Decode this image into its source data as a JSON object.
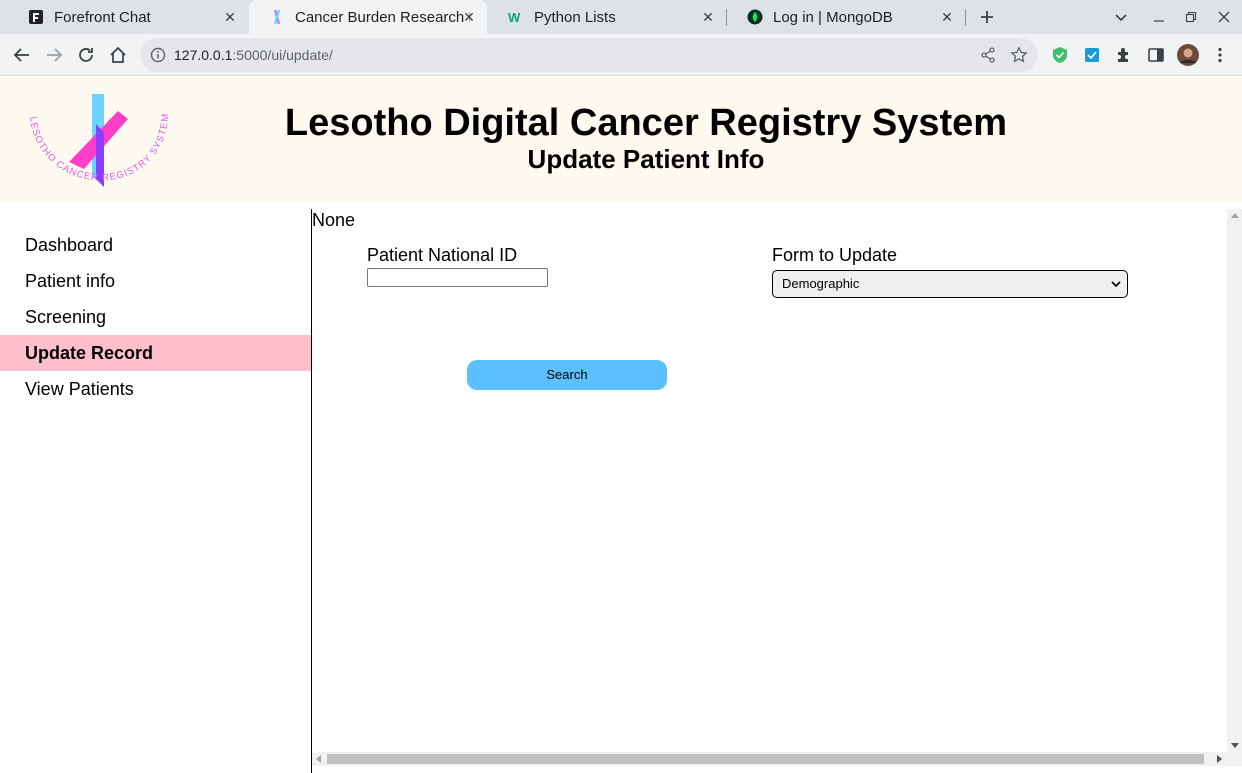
{
  "browser": {
    "tabs": [
      {
        "title": "Forefront Chat",
        "icon": "forefront-icon"
      },
      {
        "title": "Cancer Burden Research Platform",
        "icon": "ribbon-icon",
        "active": true
      },
      {
        "title": "Python Lists",
        "icon": "w3schools-icon"
      },
      {
        "title": "Log in | MongoDB",
        "icon": "mongodb-leaf-icon"
      }
    ],
    "url_host": "127.0.0.1",
    "url_rest": ":5000/ui/update/"
  },
  "header": {
    "title": "Lesotho Digital Cancer Registry System",
    "subtitle": "Update Patient Info",
    "logo_text": "LESOTHO CANCER REGISTRY SYSTEM"
  },
  "sidebar": {
    "items": [
      {
        "label": "Dashboard"
      },
      {
        "label": "Patient info"
      },
      {
        "label": "Screening"
      },
      {
        "label": "Update Record",
        "active": true
      },
      {
        "label": "View Patients"
      }
    ]
  },
  "main": {
    "message": "None",
    "national_id_label": "Patient National ID",
    "national_id_value": "",
    "form_label": "Form to Update",
    "form_selected": "Demographic",
    "search_label": "Search"
  },
  "colors": {
    "header_bg": "#fffaf0",
    "nav_active_bg": "#ffc0cb",
    "search_button_bg": "#5bc0ff"
  }
}
